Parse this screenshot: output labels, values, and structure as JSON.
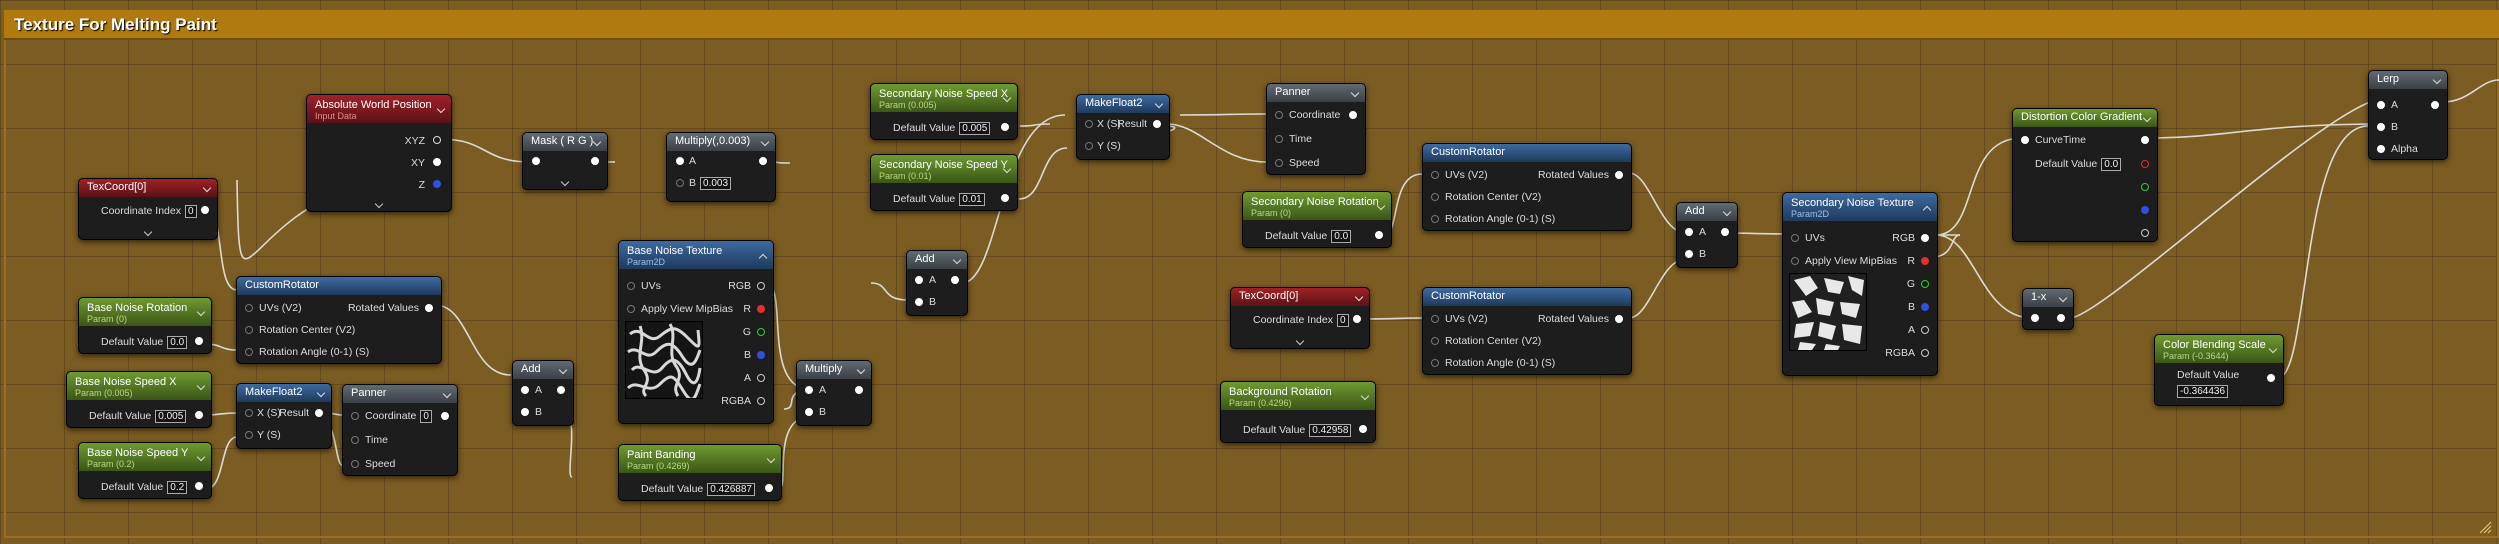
{
  "comment": {
    "title": "Texture For Melting Paint"
  },
  "nodes": {
    "texcoord0": {
      "title": "TexCoord[0]",
      "param_label": "Coordinate Index",
      "param_value": "0"
    },
    "abs_world_pos": {
      "title": "Absolute World Position",
      "subtitle": "Input Data",
      "out_xyz": "XYZ",
      "out_xy": "XY",
      "out_z": "Z"
    },
    "mask_rg": {
      "title": "Mask ( R G )"
    },
    "multiply_003": {
      "title": "Multiply(,0.003)",
      "in_a": "A",
      "in_b": "B",
      "b_value": "0.003"
    },
    "sec_noise_speed_x": {
      "title": "Secondary Noise Speed X",
      "subtitle": "Param (0.005)",
      "param_label": "Default Value",
      "param_value": "0.005"
    },
    "sec_noise_speed_y": {
      "title": "Secondary Noise Speed Y",
      "subtitle": "Param (0.01)",
      "param_label": "Default Value",
      "param_value": "0.01"
    },
    "makefloat2_top": {
      "title": "MakeFloat2",
      "in_x": "X (S)",
      "in_y": "Y (S)",
      "out_result": "Result"
    },
    "panner_top": {
      "title": "Panner",
      "in_coord": "Coordinate",
      "in_time": "Time",
      "in_speed": "Speed"
    },
    "sec_noise_rotation": {
      "title": "Secondary Noise Rotation",
      "subtitle": "Param (0)",
      "param_label": "Default Value",
      "param_value": "0.0"
    },
    "custom_rot_top": {
      "title": "CustomRotator",
      "in_uvs": "UVs (V2)",
      "in_center": "Rotation Center (V2)",
      "in_angle": "Rotation Angle (0-1) (S)",
      "out": "Rotated Values"
    },
    "base_noise_rotation": {
      "title": "Base Noise Rotation",
      "subtitle": "Param (0)",
      "param_label": "Default Value",
      "param_value": "0.0"
    },
    "custom_rot_left": {
      "title": "CustomRotator",
      "in_uvs": "UVs (V2)",
      "in_center": "Rotation Center (V2)",
      "in_angle": "Rotation Angle (0-1) (S)",
      "out": "Rotated Values"
    },
    "base_noise_speed_x": {
      "title": "Base Noise Speed X",
      "subtitle": "Param (0.005)",
      "param_label": "Default Value",
      "param_value": "0.005"
    },
    "base_noise_speed_y": {
      "title": "Base Noise Speed Y",
      "subtitle": "Param (0.2)",
      "param_label": "Default Value",
      "param_value": "0.2"
    },
    "makefloat2_bottom": {
      "title": "MakeFloat2",
      "in_x": "X (S)",
      "in_y": "Y (S)",
      "out_result": "Result"
    },
    "panner_bottom": {
      "title": "Panner",
      "in_coord": "Coordinate",
      "coord_value": "0",
      "in_time": "Time",
      "in_speed": "Speed"
    },
    "add_left": {
      "title": "Add",
      "in_a": "A",
      "in_b": "B"
    },
    "base_noise_texture": {
      "title": "Base Noise Texture",
      "subtitle": "Param2D",
      "in_uvs": "UVs",
      "in_mip": "Apply View MipBias",
      "out_rgb": "RGB",
      "out_r": "R",
      "out_g": "G",
      "out_b": "B",
      "out_a": "A",
      "out_rgba": "RGBA"
    },
    "paint_banding": {
      "title": "Paint Banding",
      "subtitle": "Param (0.4269)",
      "param_label": "Default Value",
      "param_value": "0.426887"
    },
    "multiply_mid": {
      "title": "Multiply",
      "in_a": "A",
      "in_b": "B"
    },
    "add_mid": {
      "title": "Add",
      "in_a": "A",
      "in_b": "B"
    },
    "texcoord0_b": {
      "title": "TexCoord[0]",
      "param_label": "Coordinate Index",
      "param_value": "0"
    },
    "background_rotation": {
      "title": "Background Rotation",
      "subtitle": "Param (0.4296)",
      "param_label": "Default Value",
      "param_value": "0.42958"
    },
    "custom_rot_bottom": {
      "title": "CustomRotator",
      "in_uvs": "UVs (V2)",
      "in_center": "Rotation Center (V2)",
      "in_angle": "Rotation Angle (0-1) (S)",
      "out": "Rotated Values"
    },
    "add_right": {
      "title": "Add",
      "in_a": "A",
      "in_b": "B"
    },
    "sec_noise_texture": {
      "title": "Secondary Noise Texture",
      "subtitle": "Param2D",
      "in_uvs": "UVs",
      "in_mip": "Apply View MipBias",
      "out_rgb": "RGB",
      "out_r": "R",
      "out_g": "G",
      "out_b": "B",
      "out_a": "A",
      "out_rgba": "RGBA"
    },
    "distortion_gradient": {
      "title": "Distortion Color Gradient",
      "in_curvetime": "CurveTime",
      "param_label": "Default Value",
      "param_value": "0.0"
    },
    "one_minus": {
      "title": "1-x"
    },
    "color_blending_scale": {
      "title": "Color Blending Scale",
      "subtitle": "Param (-0.3644)",
      "param_label": "Default Value",
      "param_value": "-0.364436"
    },
    "lerp": {
      "title": "Lerp",
      "in_a": "A",
      "in_b": "B",
      "in_alpha": "Alpha"
    }
  },
  "colors": {
    "comment_bg": "#b07a10",
    "graph_bg": "#7b5c22",
    "param_header": "#6f9a32",
    "texcoord_header": "#a02228",
    "function_header": "#3d6aa0",
    "math_header": "#616a72"
  }
}
